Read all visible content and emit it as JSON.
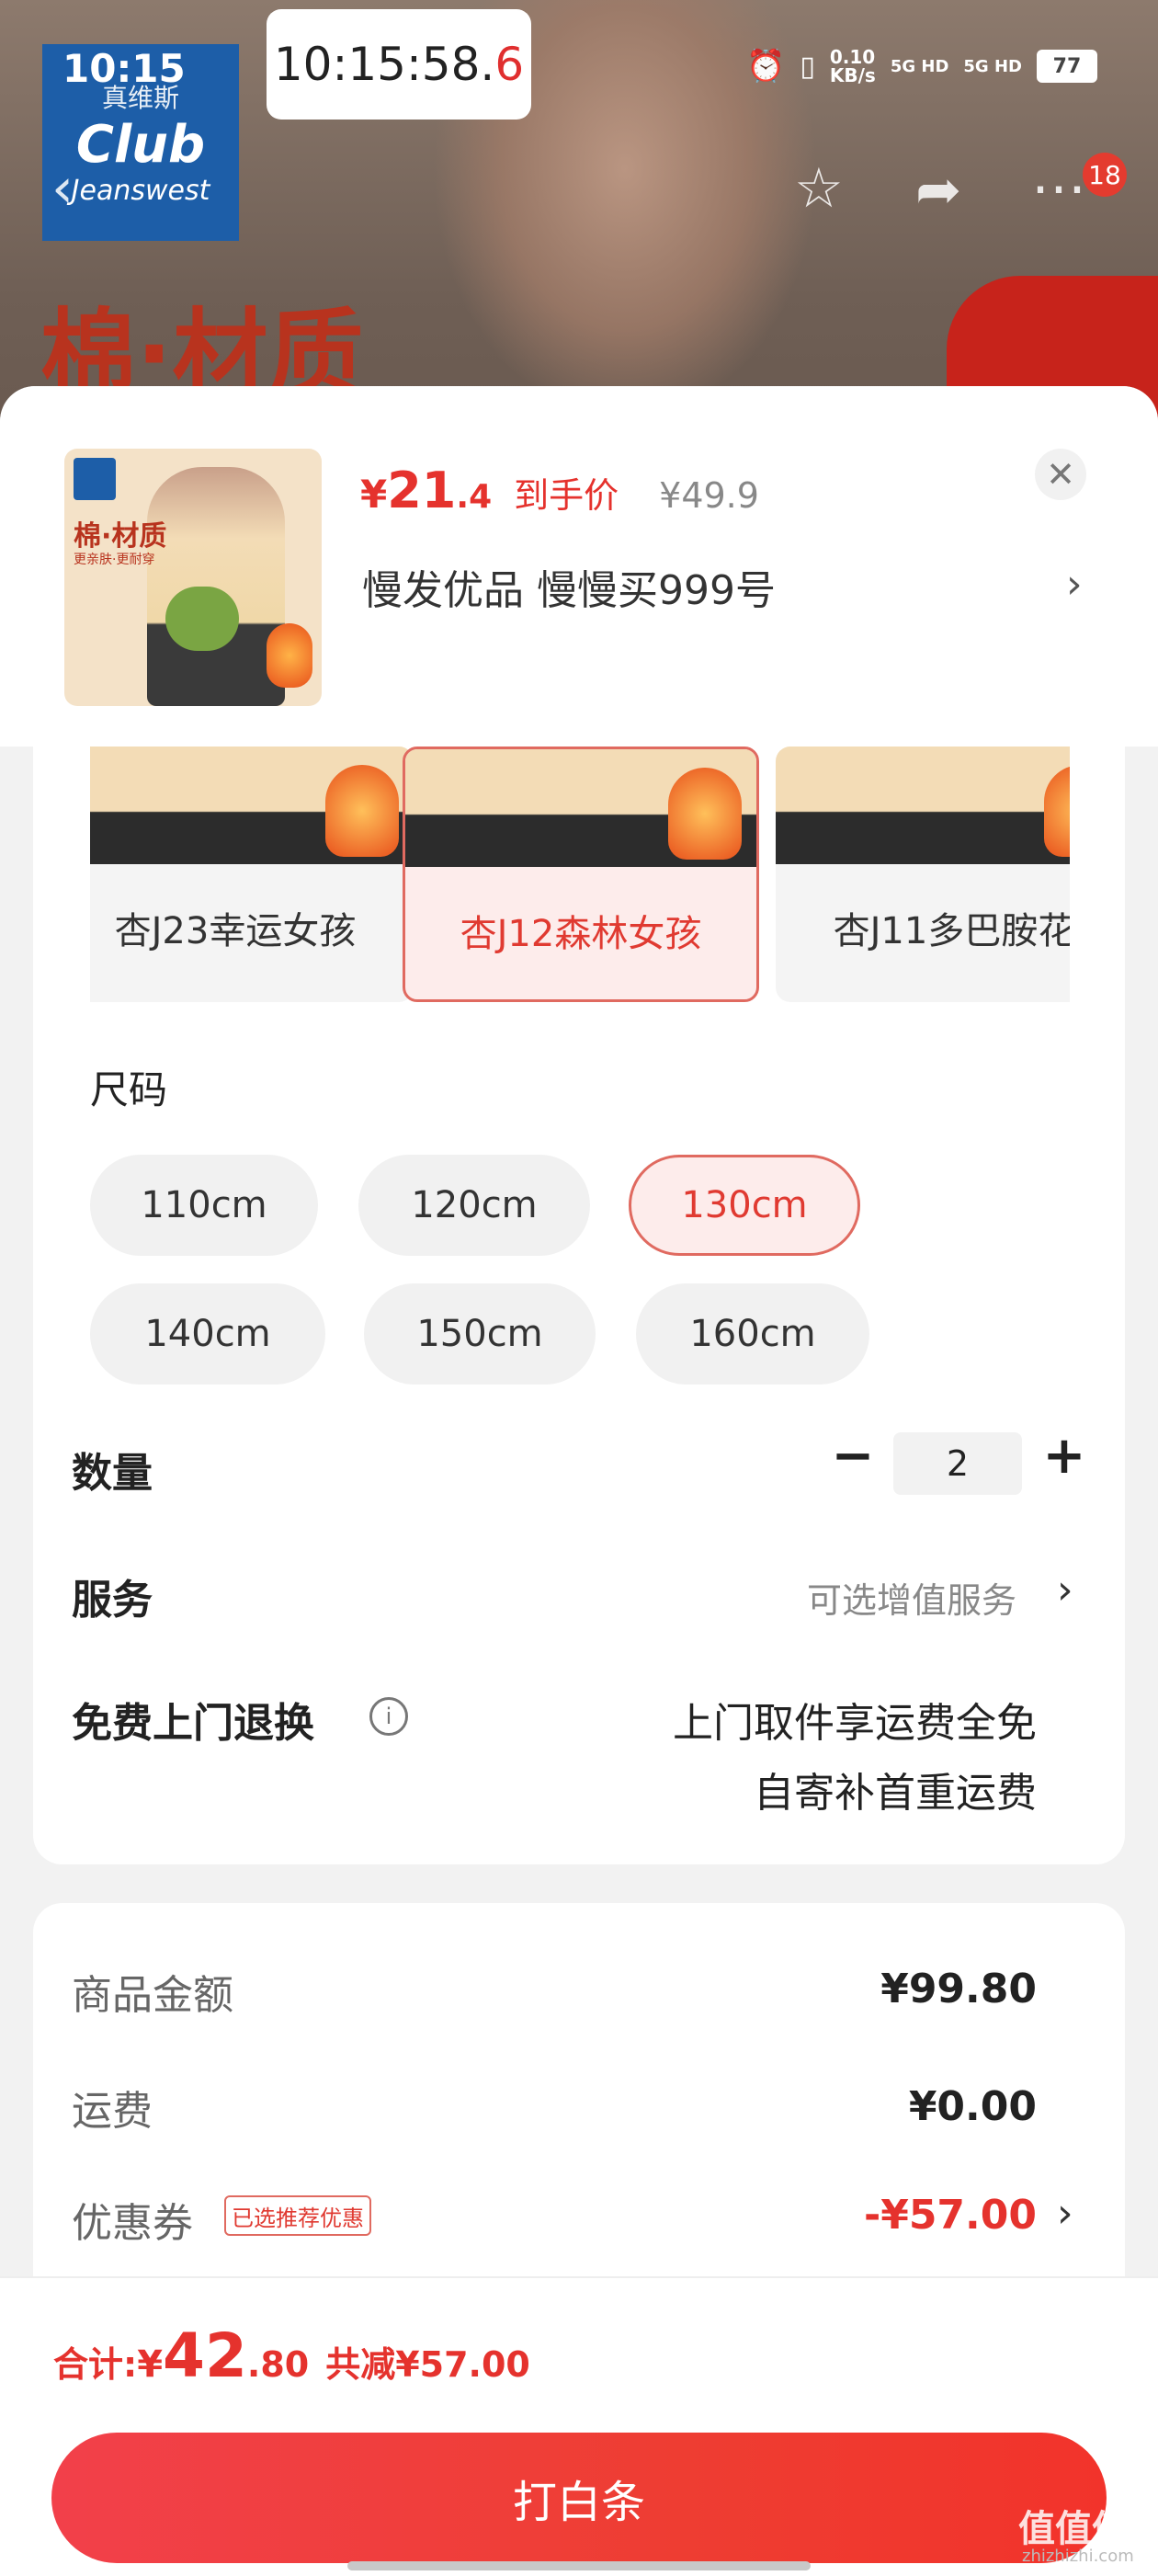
{
  "status_bar": {
    "time": "10:15",
    "clock_overlay_main": "10:15:58.",
    "clock_overlay_ms": "6",
    "net_speed": "0.10\nKB/s",
    "sim1": "5G HD",
    "sim2": "5G HD",
    "battery": "77"
  },
  "header": {
    "badge_count": "18",
    "brand_logo_line1": "真维斯",
    "brand_logo_line2": "Club",
    "brand_logo_line3": "Jeanswest",
    "promo_text": "棉·材质"
  },
  "product": {
    "price_currency": "¥",
    "price_int": "21",
    "price_dec": ".4",
    "price_tag": "到手价",
    "original_price": "¥49.9",
    "store_name": "慢发优品  慢慢买999号",
    "thumb_title": "棉·材质",
    "thumb_subtitle": "更亲肤·更耐穿"
  },
  "variants": [
    {
      "label": "杏J23幸运女孩",
      "selected": false
    },
    {
      "label": "杏J12森林女孩",
      "selected": true
    },
    {
      "label": "杏J11多巴胺花",
      "selected": false
    }
  ],
  "size": {
    "title": "尺码",
    "options": [
      {
        "label": "110cm",
        "selected": false
      },
      {
        "label": "120cm",
        "selected": false
      },
      {
        "label": "130cm",
        "selected": true
      },
      {
        "label": "140cm",
        "selected": false
      },
      {
        "label": "150cm",
        "selected": false
      },
      {
        "label": "160cm",
        "selected": false
      }
    ]
  },
  "quantity": {
    "label": "数量",
    "minus": "−",
    "value": "2",
    "plus": "+"
  },
  "service": {
    "label": "服务",
    "value": "可选增值服务"
  },
  "returns": {
    "label": "免费上门退换",
    "line1": "上门取件享运费全免",
    "line2": "自寄补首重运费"
  },
  "summary": {
    "goods_label": "商品金额",
    "goods_value": "¥99.80",
    "shipping_label": "运费",
    "shipping_value": "¥0.00",
    "coupon_label": "优惠券",
    "coupon_tag": "已选推荐优惠",
    "coupon_value": "-¥57.00"
  },
  "footer": {
    "total_label": "合计: ",
    "total_currency": "¥",
    "total_int": "42",
    "total_dec": ".80",
    "total_saving": "共减¥57.00",
    "submit_label": "打白条",
    "watermark": "值值值",
    "watermark_sub": "zhizhizhi.com"
  },
  "colors": {
    "accent_red": "#e5322d",
    "selected_border": "#e06a60",
    "selected_bg": "#fdeceb"
  }
}
